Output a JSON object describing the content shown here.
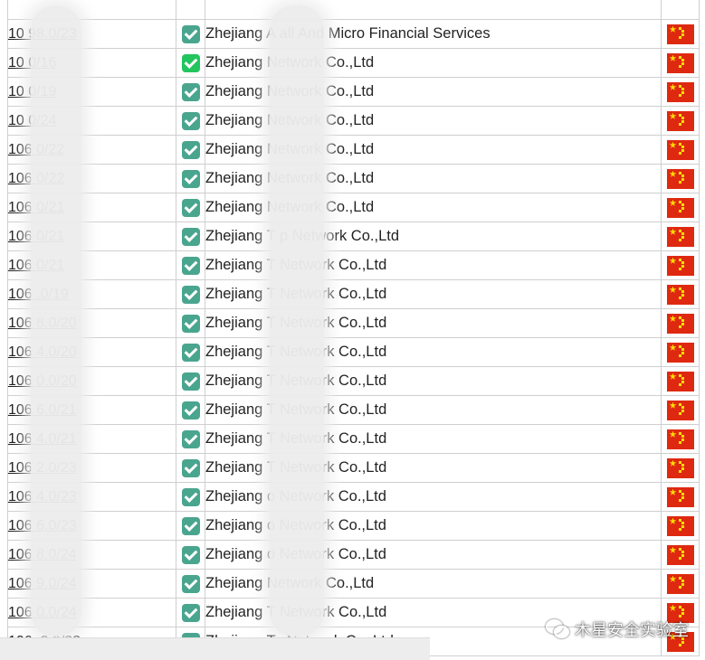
{
  "rows": [
    {
      "prefix": "10 98.0/23",
      "verified": true,
      "org": "Zhejiang A all And Micro Financial Services",
      "country": "CN"
    },
    {
      "prefix": "10 0/16",
      "verified": true,
      "org": "Zhejiang Network Co.,Ltd",
      "country": "CN"
    },
    {
      "prefix": "10 0/19",
      "verified": true,
      "org": "Zhejiang Network Co.,Ltd",
      "country": "CN"
    },
    {
      "prefix": "10 0/24",
      "verified": true,
      "org": "Zhejiang Network Co.,Ltd",
      "country": "CN"
    },
    {
      "prefix": "106 0/22",
      "verified": true,
      "org": "Zhejiang Network Co.,Ltd",
      "country": "CN"
    },
    {
      "prefix": "106 0/22",
      "verified": true,
      "org": "Zhejiang Network Co.,Ltd",
      "country": "CN"
    },
    {
      "prefix": "106 0/21",
      "verified": true,
      "org": "Zhejiang Network Co.,Ltd",
      "country": "CN"
    },
    {
      "prefix": "106 0/21",
      "verified": true,
      "org": "Zhejiang T p Network Co.,Ltd",
      "country": "CN"
    },
    {
      "prefix": "106 0/21",
      "verified": true,
      "org": "Zhejiang T Network Co.,Ltd",
      "country": "CN"
    },
    {
      "prefix": "106 .0/19",
      "verified": true,
      "org": "Zhejiang T Network Co.,Ltd",
      "country": "CN"
    },
    {
      "prefix": "106 8.0/20",
      "verified": true,
      "org": "Zhejiang T Network Co.,Ltd",
      "country": "CN"
    },
    {
      "prefix": "106 4.0/20",
      "verified": true,
      "org": "Zhejiang T Network Co.,Ltd",
      "country": "CN"
    },
    {
      "prefix": "106 0.0/20",
      "verified": true,
      "org": "Zhejiang T Network Co.,Ltd",
      "country": "CN"
    },
    {
      "prefix": "106 6.0/21",
      "verified": true,
      "org": "Zhejiang T Network Co.,Ltd",
      "country": "CN"
    },
    {
      "prefix": "106 4.0/21",
      "verified": true,
      "org": "Zhejiang T Network Co.,Ltd",
      "country": "CN"
    },
    {
      "prefix": "106 2.0/23",
      "verified": true,
      "org": "Zhejiang T Network Co.,Ltd",
      "country": "CN"
    },
    {
      "prefix": "106 4.0/23",
      "verified": true,
      "org": "Zhejiang o Network Co.,Ltd",
      "country": "CN"
    },
    {
      "prefix": "106 6.0/23",
      "verified": true,
      "org": "Zhejiang o Network Co.,Ltd",
      "country": "CN"
    },
    {
      "prefix": "106 8.0/24",
      "verified": true,
      "org": "Zhejiang o Network Co.,Ltd",
      "country": "CN"
    },
    {
      "prefix": "106 9.0/24",
      "verified": true,
      "org": "Zhejiang Network Co.,Ltd",
      "country": "CN"
    },
    {
      "prefix": "106 0.0/24",
      "verified": true,
      "org": "Zhejiang T Network Co.,Ltd",
      "country": "CN"
    },
    {
      "prefix": "106. 2.0/23",
      "verified": true,
      "org": "Zhejiang Ta Network Co.,Ltd",
      "country": "CN"
    }
  ],
  "watermark": {
    "icon": "wechat-icon",
    "text": "木星安全实验室"
  },
  "colors": {
    "check_green": "#4aa58f",
    "check_bright": "#22c55e",
    "flag_red": "#de2910",
    "flag_star": "#ffde00",
    "border": "#cfcfcf"
  }
}
